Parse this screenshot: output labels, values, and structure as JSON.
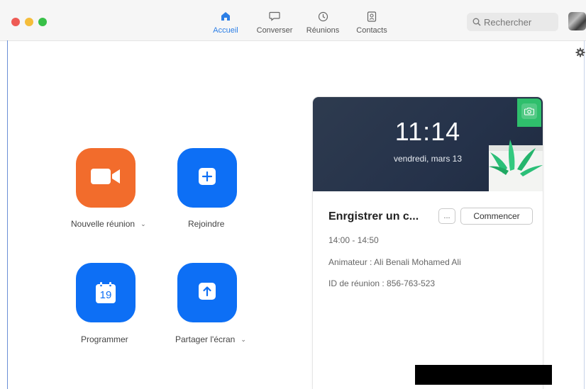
{
  "nav": {
    "tabs": [
      {
        "label": "Accueil",
        "icon": "home-icon",
        "active": true
      },
      {
        "label": "Converser",
        "icon": "chat-icon",
        "active": false
      },
      {
        "label": "Réunions",
        "icon": "clock-icon",
        "active": false
      },
      {
        "label": "Contacts",
        "icon": "contacts-icon",
        "active": false
      }
    ],
    "accent": "#2d7fe6"
  },
  "search": {
    "placeholder": "Rechercher"
  },
  "actions": [
    {
      "label": "Nouvelle réunion",
      "icon": "video-camera-icon",
      "color": "#f26c2c",
      "has_menu": true
    },
    {
      "label": "Rejoindre",
      "icon": "plus-icon",
      "color": "#0d6ff5",
      "has_menu": false
    },
    {
      "label": "Programmer",
      "icon": "calendar-icon",
      "color": "#0d6ff5",
      "calendar_day": "19",
      "has_menu": false
    },
    {
      "label": "Partager l'écran",
      "icon": "share-up-arrow-icon",
      "color": "#0d6ff5",
      "has_menu": true
    }
  ],
  "card": {
    "time": "11:14",
    "date": "vendredi, mars 13",
    "title": "Enrgistrer un c...",
    "more_label": "...",
    "start_label": "Commencer",
    "time_range": "14:00 - 14:50",
    "host": "Animateur : Ali Benali Mohamed Ali",
    "meeting_id": "ID de réunion : 856-763-523"
  }
}
